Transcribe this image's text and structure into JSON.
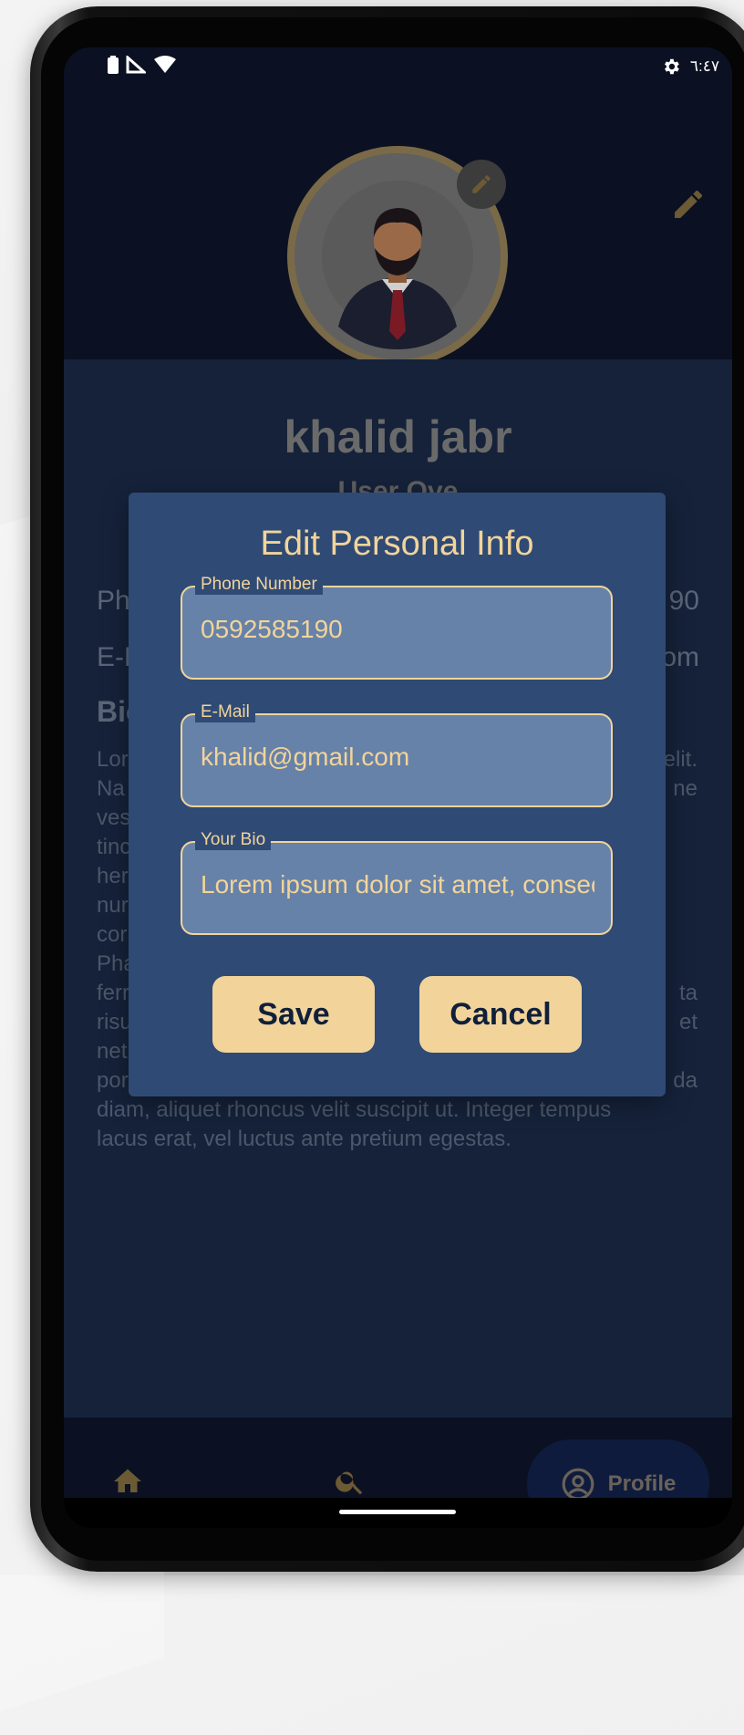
{
  "status_bar": {
    "time": "٦:٤٧",
    "icons": [
      "battery-icon",
      "signal-icon",
      "wifi-icon",
      "settings-icon"
    ]
  },
  "profile": {
    "name": "khalid jabr",
    "subtitle": "User Ove",
    "phone_label": "Ph",
    "phone_value_tail": "90",
    "email_label": "E-M",
    "email_value_tail": "om",
    "bio_title": "Bio",
    "bio_text": "Lorem ipsum dolor sit amet, consectetur adipiscing elit. Nam vestibulum tincidunt hendrerit numquam conset Phasellus fermentum risus et netus porta diam, aliquet rhoncus velit suscipit ut. Integer tempus lacus erat, vel luctus ante pretium egestas."
  },
  "bio_visible": {
    "line1_left": "Lor",
    "line1_right": "elit.",
    "line2_left": "Na",
    "line2_right": "ne",
    "line3_left": "ves",
    "line4_left": "tinc",
    "line5_left": "her",
    "line6_left": "nur",
    "line7_left": "cor",
    "line8_left": "Pha",
    "line9_left": "ferr",
    "line9_right": "ta",
    "line10_left": "risu",
    "line10_right": "et",
    "line11_left": "net",
    "line12_left": "por",
    "line12_right": "da",
    "line13": "diam, aliquet rhoncus velit suscipit ut. Integer tempus",
    "line14": "lacus erat, vel luctus ante pretium egestas."
  },
  "dialog": {
    "title": "Edit Personal Info",
    "fields": [
      {
        "label": "Phone Number",
        "value": "0592585190"
      },
      {
        "label": "E-Mail",
        "value": "khalid@gmail.com"
      },
      {
        "label": "Your Bio",
        "value": "Lorem ipsum dolor sit amet, consectetur"
      }
    ],
    "save_label": "Save",
    "cancel_label": "Cancel"
  },
  "bottom_nav": {
    "items": [
      {
        "icon": "home-icon"
      },
      {
        "icon": "search-icon"
      },
      {
        "icon": "account-circle-icon",
        "label": "Profile"
      }
    ]
  },
  "colors": {
    "accent": "#f2d49a",
    "dialog_bg": "#2f4a75",
    "field_bg": "#6782a8",
    "header_bg": "#0b1122",
    "body_bg": "#15223a"
  }
}
